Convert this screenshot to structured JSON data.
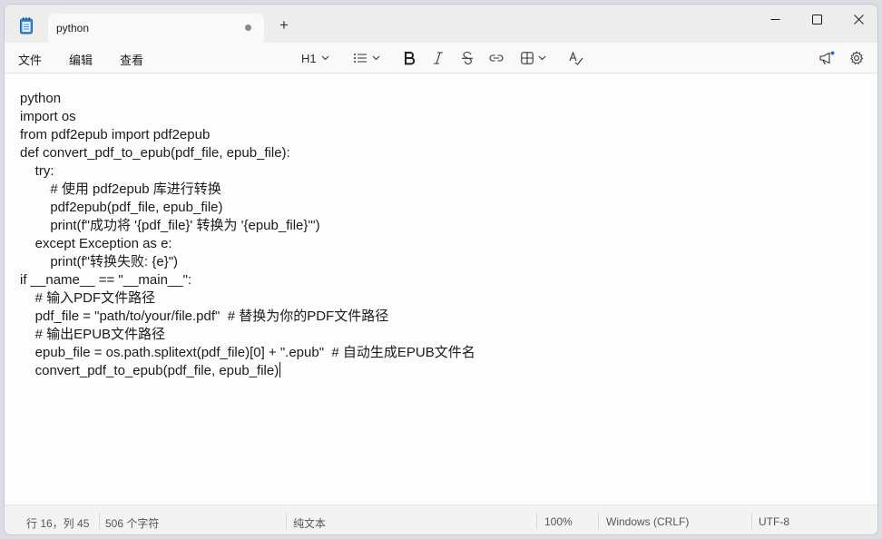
{
  "tab": {
    "title": "python",
    "new_tab_label": "+"
  },
  "menu": {
    "file": "文件",
    "edit": "编辑",
    "view": "查看"
  },
  "toolbar": {
    "heading_label": "H1"
  },
  "editor": {
    "lines": [
      "python",
      "import os",
      "from pdf2epub import pdf2epub",
      "def convert_pdf_to_epub(pdf_file, epub_file):",
      "    try:",
      "        # 使用 pdf2epub 库进行转换",
      "        pdf2epub(pdf_file, epub_file)",
      "        print(f\"成功将 '{pdf_file}' 转换为 '{epub_file}'\")",
      "    except Exception as e:",
      "        print(f\"转换失败: {e}\")",
      "if __name__ == \"__main__\":",
      "    # 输入PDF文件路径",
      "    pdf_file = \"path/to/your/file.pdf\"  # 替换为你的PDF文件路径",
      "    # 输出EPUB文件路径",
      "    epub_file = os.path.splitext(pdf_file)[0] + \".epub\"  # 自动生成EPUB文件名",
      "    convert_pdf_to_epub(pdf_file, epub_file)"
    ]
  },
  "status": {
    "position": "行 16，列 45",
    "char_count": "506 个字符",
    "format": "纯文本",
    "zoom": "100%",
    "line_ending": "Windows (CRLF)",
    "encoding": "UTF-8"
  }
}
